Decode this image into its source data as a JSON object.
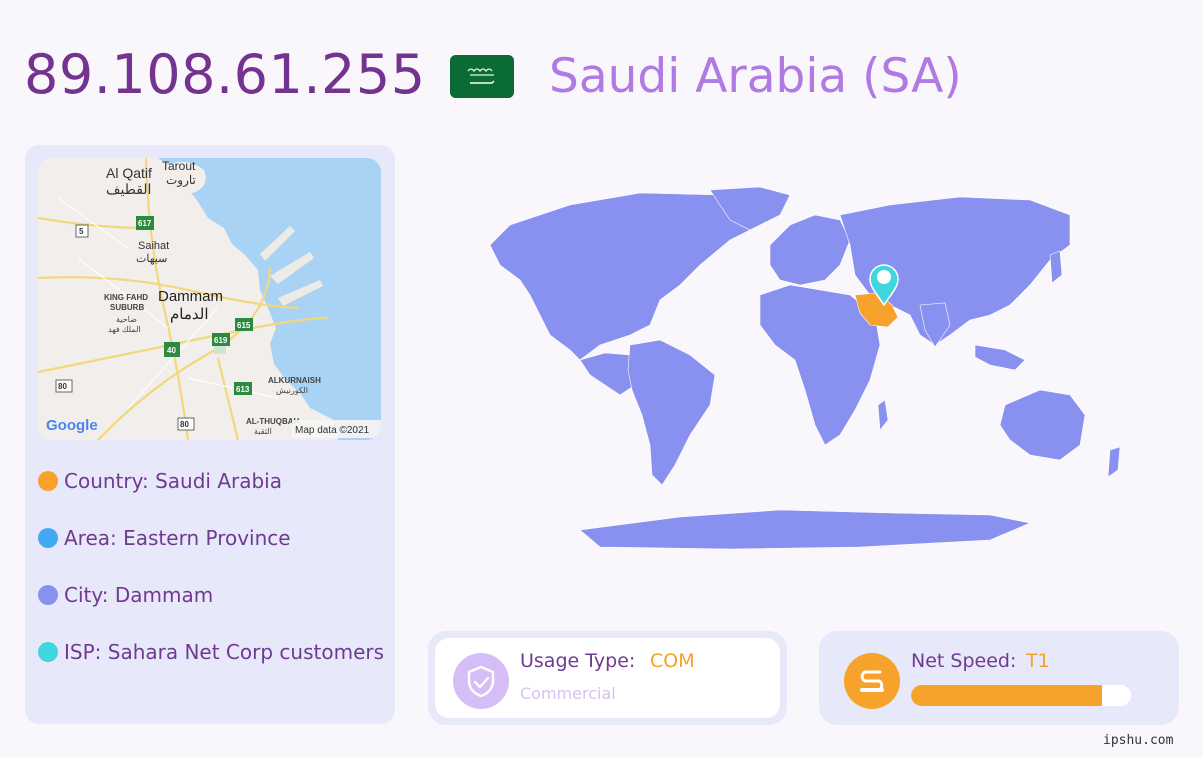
{
  "header": {
    "ip": "89.108.61.255",
    "country_title": "Saudi Arabia (SA)"
  },
  "mini_map": {
    "labels": {
      "al_qatif": "Al Qatif",
      "al_qatif_ar": "القطيف",
      "tarout": "Tarout",
      "tarout_ar": "تاروت",
      "saihat": "Saihat",
      "saihat_ar": "سيهات",
      "king_fahd_1": "KING FAHD",
      "king_fahd_2": "SUBURB",
      "king_fahd_ar1": "ضاحية",
      "king_fahd_ar2": "الملك فهد",
      "dammam": "Dammam",
      "dammam_ar": "الدمام",
      "alkurnaish": "ALKURNAISH",
      "alkurnaish_ar": "الكورنيش",
      "al_thuqbah": "AL-THUQBAH",
      "al_thuqbah_ar": "الثقبة"
    },
    "road_shields": [
      "617",
      "5",
      "615",
      "619",
      "40",
      "613",
      "80",
      "80"
    ],
    "google": "Google",
    "map_credit": "Map data ©2021"
  },
  "info": [
    {
      "label": "Country: Saudi Arabia",
      "color": "#f9a02b"
    },
    {
      "label": "Area: Eastern Province",
      "color": "#44a7f2"
    },
    {
      "label": "City: Dammam",
      "color": "#8890f0"
    },
    {
      "label": "ISP: Sahara Net Corp customers",
      "color": "#3fd6de"
    }
  ],
  "usage": {
    "label": "Usage Type:",
    "value": "COM",
    "description": "Commercial"
  },
  "speed": {
    "label": "Net Speed:",
    "value": "T1",
    "level": 0.87
  },
  "watermark": "ipshu.com",
  "colors": {
    "title_purple": "#74338f",
    "country_lavender": "#b07ae3",
    "land": "#8890f0",
    "highlight": "#f7a22a",
    "pin": "#3fd6de",
    "panel": "#e7e9fb"
  },
  "icons": {
    "flag": "saudi-arabia-flag",
    "usage": "shield-check-icon",
    "speed": "speed-s-icon",
    "pin": "location-pin-icon"
  }
}
